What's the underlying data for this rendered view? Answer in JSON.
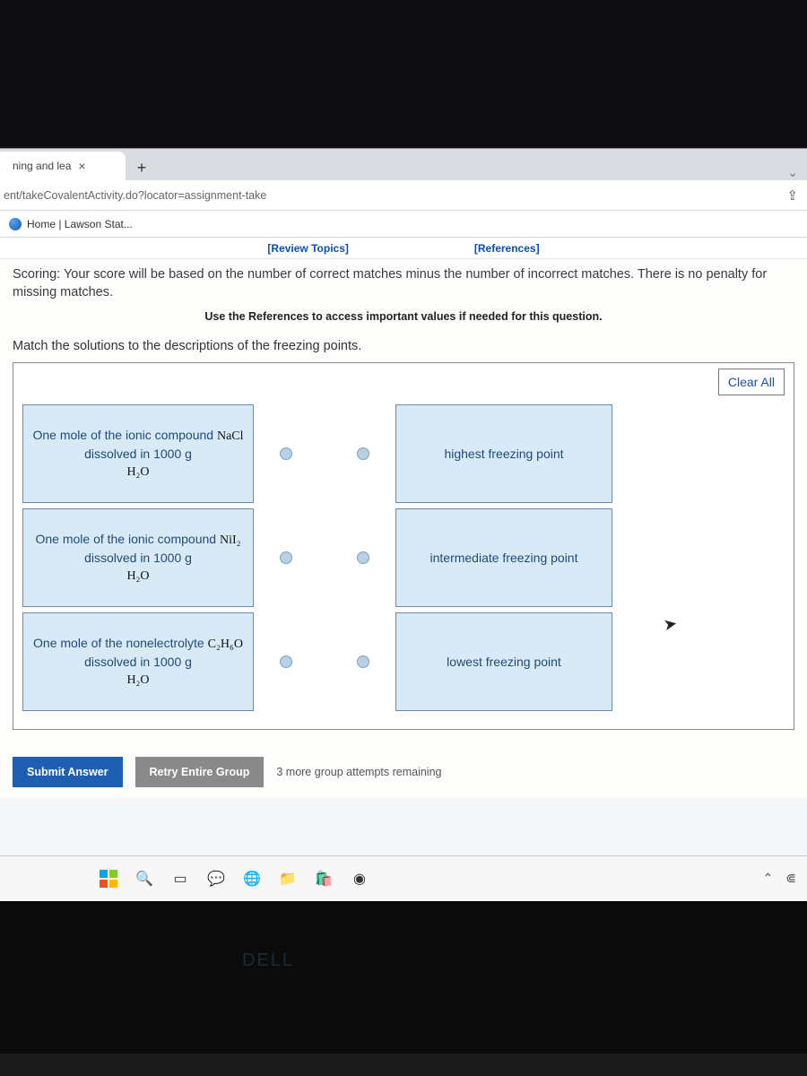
{
  "browser": {
    "tab_title": "ning and lea",
    "url": "ent/takeCovalentActivity.do?locator=assignment-take",
    "bookmark": "Home | Lawson Stat..."
  },
  "linkbar": {
    "review": "[Review Topics]",
    "references": "[References]"
  },
  "content": {
    "scoring": "Scoring: Your score will be based on the number of correct matches minus the number of incorrect matches. There is no penalty for missing matches.",
    "refs_note": "Use the References to access important values if needed for this question.",
    "match_instr": "Match the solutions to the descriptions of the freezing points.",
    "clear_all": "Clear All"
  },
  "pairs": {
    "left": [
      {
        "pre": "One mole of the ionic compound ",
        "formula": "NaCl",
        "post": " dissolved in 1000 g ",
        "solvent": "H₂O"
      },
      {
        "pre": "One mole of the ionic compound ",
        "formula": "NiI₂",
        "post": " dissolved in 1000 g ",
        "solvent": "H₂O"
      },
      {
        "pre": "One mole of the nonelectrolyte ",
        "formula": "C₂H₆O",
        "post": " dissolved in 1000 g ",
        "solvent": "H₂O"
      }
    ],
    "right": [
      "highest freezing point",
      "intermediate freezing point",
      "lowest freezing point"
    ]
  },
  "buttons": {
    "submit": "Submit Answer",
    "retry": "Retry Entire Group",
    "attempts": "3 more group attempts remaining"
  },
  "brand": "DELL"
}
